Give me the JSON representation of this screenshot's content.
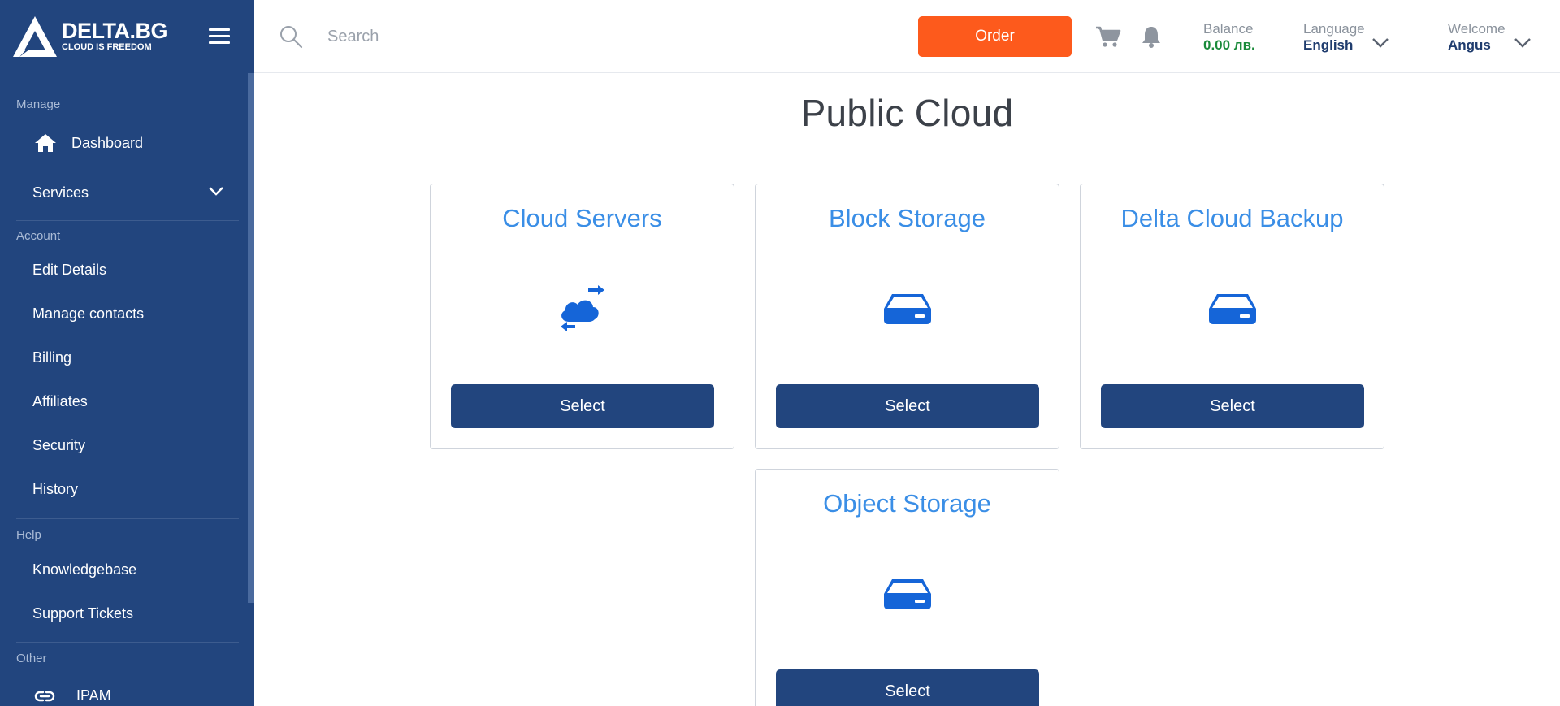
{
  "brand": {
    "name": "DELTA.BG",
    "tagline": "CLOUD IS FREEDOM"
  },
  "sidebar": {
    "sections": [
      {
        "label": "Manage"
      },
      {
        "label": "Account"
      },
      {
        "label": "Help"
      },
      {
        "label": "Other"
      }
    ],
    "items": [
      {
        "label": "Dashboard",
        "icon": "home-icon"
      },
      {
        "label": "Services",
        "icon": "chevron-down-icon"
      },
      {
        "label": "Edit Details"
      },
      {
        "label": "Manage contacts"
      },
      {
        "label": "Billing"
      },
      {
        "label": "Affiliates"
      },
      {
        "label": "Security"
      },
      {
        "label": "History"
      },
      {
        "label": "Knowledgebase"
      },
      {
        "label": "Support Tickets"
      },
      {
        "label": "IPAM",
        "icon": "link-icon"
      }
    ]
  },
  "header": {
    "search_placeholder": "Search",
    "order_label": "Order",
    "balance_label": "Balance",
    "balance_value": "0.00 лв.",
    "language_label": "Language",
    "language_value": "English",
    "welcome_label": "Welcome",
    "welcome_value": "Angus"
  },
  "main": {
    "title": "Public Cloud",
    "cards": [
      {
        "title": "Cloud Servers",
        "icon": "cloud-sync-icon",
        "button": "Select"
      },
      {
        "title": "Block Storage",
        "icon": "storage-drive-icon",
        "button": "Select"
      },
      {
        "title": "Delta Cloud Backup",
        "icon": "storage-drive-icon",
        "button": "Select"
      },
      {
        "title": "Object Storage",
        "icon": "storage-drive-icon",
        "button": "Select"
      }
    ]
  },
  "colors": {
    "sidebar_bg": "#22457e",
    "order_button": "#fd5a1c",
    "card_title": "#3a8ee6",
    "icon_blue": "#1565d8",
    "balance_green": "#1a8a3a",
    "header_value_navy": "#1f3c6e"
  }
}
